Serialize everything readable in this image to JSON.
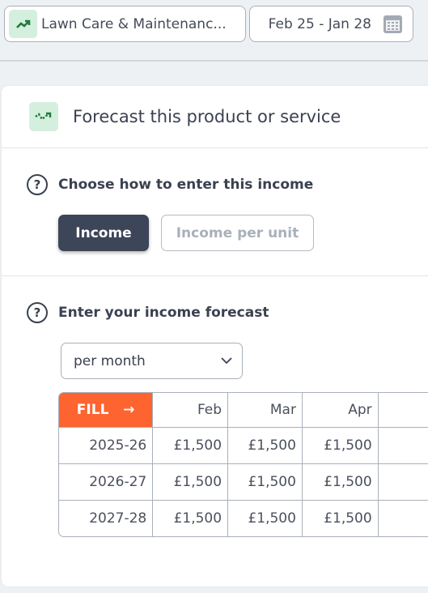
{
  "top": {
    "product_label": "Lawn Care & Maintenanc...",
    "date_range": "Feb 25 - Jan 28"
  },
  "card": {
    "title": "Forecast this product or service",
    "q1": "Choose how to enter this income",
    "options": [
      "Income",
      "Income per unit"
    ],
    "selected_option": "Income",
    "q2": "Enter your income forecast",
    "period_select": "per month",
    "help_icon": "?"
  },
  "table": {
    "fill_label": "FILL",
    "fill_arrow": "→",
    "columns": [
      "Feb",
      "Mar",
      "Apr",
      ""
    ],
    "rows": [
      {
        "year": "2025-26",
        "values": [
          "£1,500",
          "£1,500",
          "£1,500",
          ""
        ]
      },
      {
        "year": "2026-27",
        "values": [
          "£1,500",
          "£1,500",
          "£1,500",
          ""
        ]
      },
      {
        "year": "2027-28",
        "values": [
          "£1,500",
          "£1,500",
          "£1,500",
          ""
        ]
      }
    ]
  },
  "colors": {
    "accent": "#fd6430",
    "primary_button": "#3d4558",
    "icon_bg": "#d5efdf",
    "icon_green": "#1e7a3c"
  }
}
